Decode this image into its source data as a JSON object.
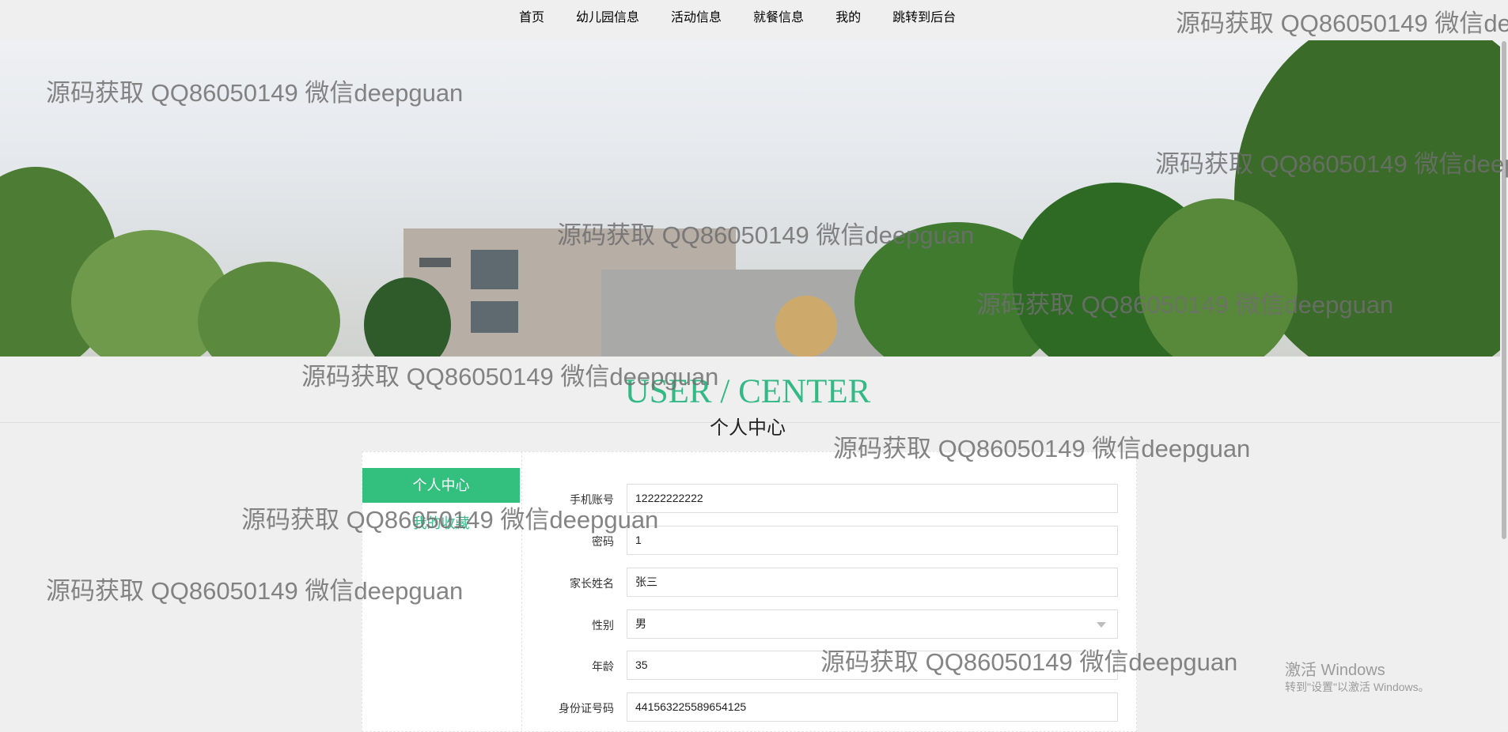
{
  "nav": {
    "items": [
      "首页",
      "幼儿园信息",
      "活动信息",
      "就餐信息",
      "我的",
      "跳转到后台"
    ]
  },
  "header": {
    "title_en": "USER / CENTER",
    "title_cn": "个人中心"
  },
  "sidebar": {
    "active": "个人中心",
    "link": "我的收藏"
  },
  "form": {
    "phone_label": "手机账号",
    "phone_value": "12222222222",
    "password_label": "密码",
    "password_value": "1",
    "parent_label": "家长姓名",
    "parent_value": "张三",
    "gender_label": "性别",
    "gender_value": "男",
    "age_label": "年龄",
    "age_value": "35",
    "id_label": "身份证号码",
    "id_value": "441563225589654125"
  },
  "watermark": "源码获取 QQ86050149 微信deepguan",
  "windows_notice": {
    "line1": "激活 Windows",
    "line2": "转到\"设置\"以激活 Windows。"
  },
  "colors": {
    "accent": "#33b985",
    "active_bg": "#33c07e"
  }
}
